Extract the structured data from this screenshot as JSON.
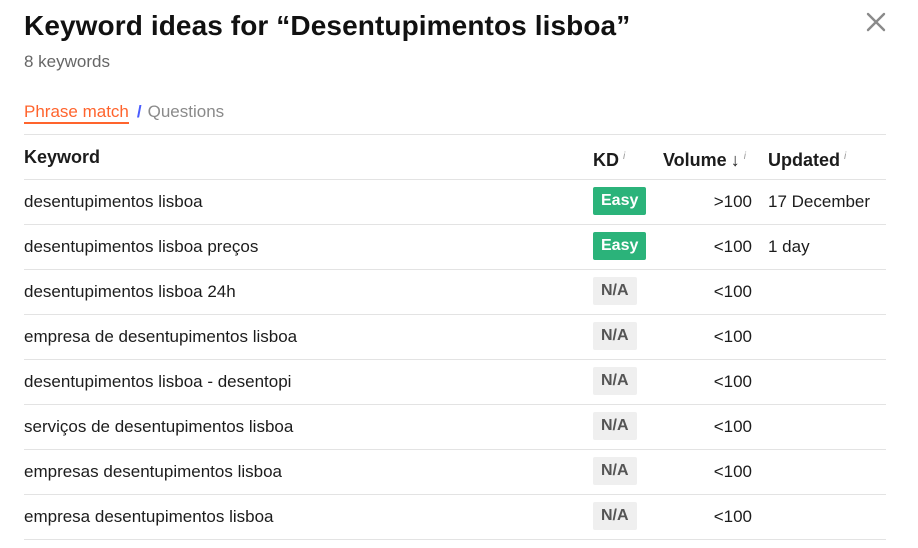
{
  "header": {
    "title": "Keyword ideas for “Desentupimentos lisboa”",
    "subtitle": "8 keywords"
  },
  "tabs": {
    "active": "Phrase match",
    "separator": "/",
    "other": "Questions"
  },
  "table": {
    "columns": {
      "keyword": "Keyword",
      "kd": "KD",
      "volume": "Volume",
      "updated": "Updated",
      "info": "i",
      "sort_arrow": "↓"
    },
    "rows": [
      {
        "keyword": "desentupimentos lisboa",
        "kd": "Easy",
        "kd_type": "easy",
        "volume": ">100",
        "updated": "17 December"
      },
      {
        "keyword": "desentupimentos lisboa preços",
        "kd": "Easy",
        "kd_type": "easy",
        "volume": "<100",
        "updated": "1 day"
      },
      {
        "keyword": "desentupimentos lisboa 24h",
        "kd": "N/A",
        "kd_type": "na",
        "volume": "<100",
        "updated": ""
      },
      {
        "keyword": "empresa de desentupimentos lisboa",
        "kd": "N/A",
        "kd_type": "na",
        "volume": "<100",
        "updated": ""
      },
      {
        "keyword": "desentupimentos lisboa - desentopi",
        "kd": "N/A",
        "kd_type": "na",
        "volume": "<100",
        "updated": ""
      },
      {
        "keyword": "serviços de desentupimentos lisboa",
        "kd": "N/A",
        "kd_type": "na",
        "volume": "<100",
        "updated": ""
      },
      {
        "keyword": "empresas desentupimentos lisboa",
        "kd": "N/A",
        "kd_type": "na",
        "volume": "<100",
        "updated": ""
      },
      {
        "keyword": "empresa desentupimentos lisboa",
        "kd": "N/A",
        "kd_type": "na",
        "volume": "<100",
        "updated": ""
      }
    ]
  },
  "colors": {
    "accent": "#ff642d",
    "easy_badge": "#2bb37a",
    "na_badge": "#efefef",
    "separator": "#4a5dff"
  },
  "icons": {
    "close": "close-icon",
    "info": "info-icon",
    "sort": "sort-down-arrow-icon"
  }
}
